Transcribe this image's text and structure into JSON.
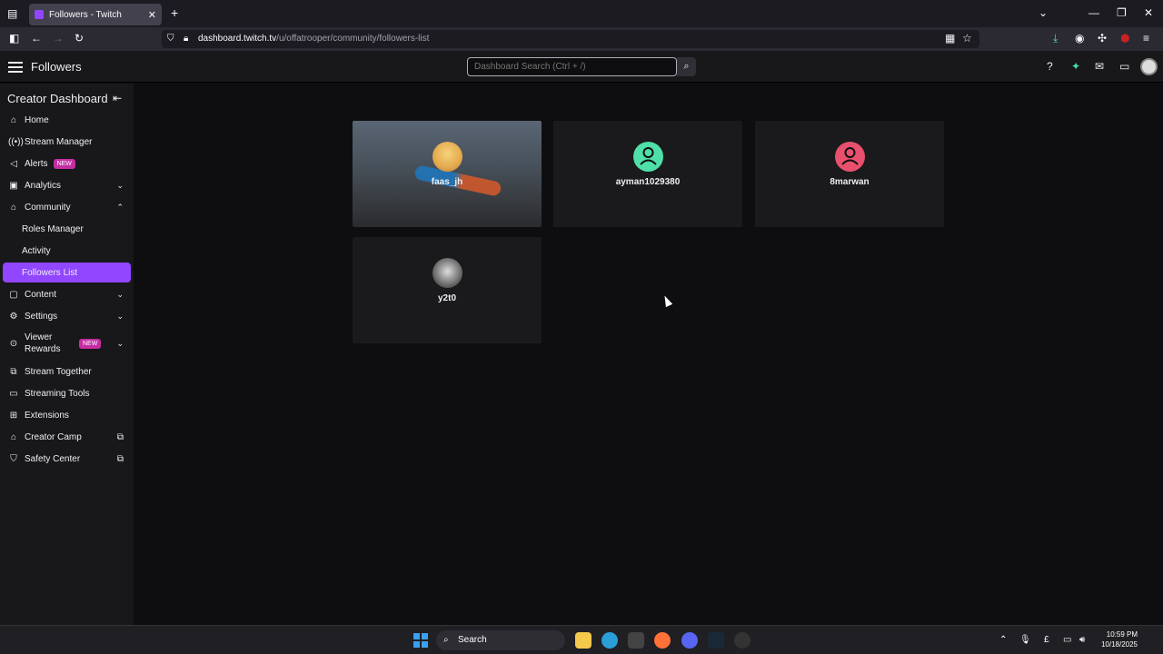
{
  "browser": {
    "tab_title": "Followers - Twitch",
    "tab_close": "✕",
    "new_tab": "+",
    "url_host": "dashboard.twitch.tv",
    "url_path": "/u/offatrooper/community/followers-list"
  },
  "topnav": {
    "page_title": "Followers",
    "search_placeholder": "Dashboard Search (Ctrl + /)"
  },
  "sidebar": {
    "title": "Creator Dashboard",
    "items": [
      {
        "label": "Home",
        "icon": "home-icon"
      },
      {
        "label": "Stream Manager",
        "icon": "broadcast-icon"
      },
      {
        "label": "Alerts",
        "icon": "megaphone-icon",
        "badge": "NEW"
      },
      {
        "label": "Analytics",
        "icon": "analytics-icon"
      },
      {
        "label": "Community",
        "icon": "community-icon"
      },
      {
        "label": "Roles Manager"
      },
      {
        "label": "Activity"
      },
      {
        "label": "Followers List"
      },
      {
        "label": "Content",
        "icon": "content-icon"
      },
      {
        "label": "Settings",
        "icon": "gear-icon"
      },
      {
        "label": "Viewer Rewards",
        "icon": "rewards-icon",
        "badge": "NEW"
      },
      {
        "label": "Stream Together",
        "icon": "stream-together-icon"
      },
      {
        "label": "Streaming Tools",
        "icon": "tools-icon"
      },
      {
        "label": "Extensions",
        "icon": "extensions-icon"
      },
      {
        "label": "Creator Camp",
        "icon": "creator-camp-icon"
      },
      {
        "label": "Safety Center",
        "icon": "shield-icon"
      }
    ]
  },
  "followers": [
    {
      "name": "faas_jh"
    },
    {
      "name": "ayman1029380"
    },
    {
      "name": "8marwan"
    },
    {
      "name": "y2t0"
    }
  ],
  "taskbar": {
    "search_label": "Search",
    "time": "10:59 PM",
    "date": "10/18/2025",
    "tray_letter": "£"
  },
  "colors": {
    "accent": "#9146ff",
    "background": "#0e0e10",
    "sidebar": "#18181b"
  }
}
